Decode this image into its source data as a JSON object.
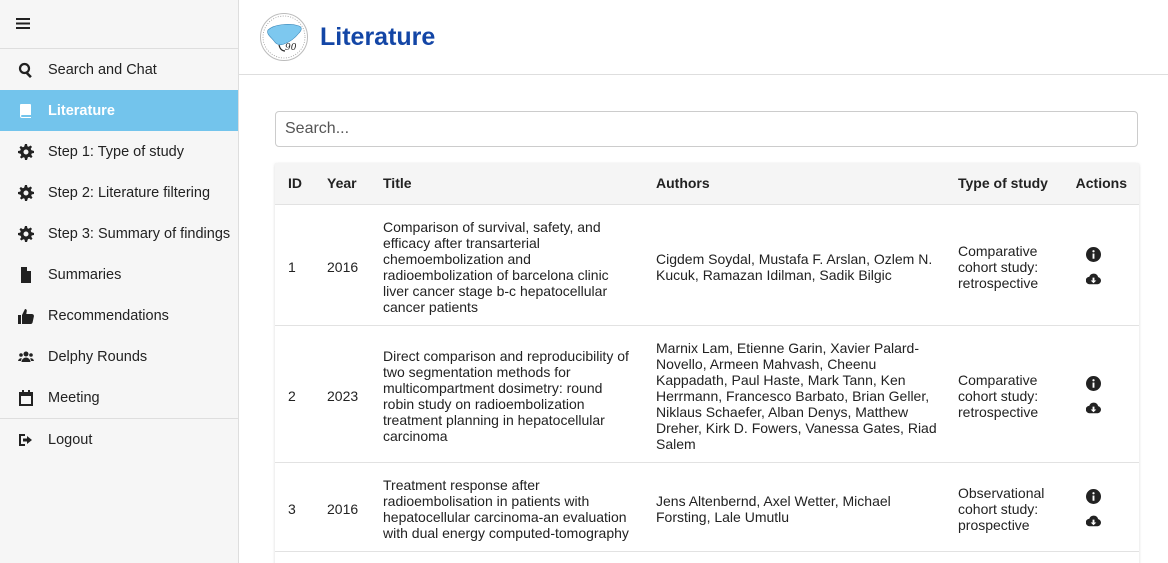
{
  "sidebar": {
    "items": [
      {
        "label": "Search and Chat",
        "icon": "search-icon"
      },
      {
        "label": "Literature",
        "icon": "book-icon",
        "active": true
      },
      {
        "label": "Step 1: Type of study",
        "icon": "gear-icon"
      },
      {
        "label": "Step 2: Literature filtering",
        "icon": "gear-icon"
      },
      {
        "label": "Step 3: Summary of findings",
        "icon": "gear-icon"
      },
      {
        "label": "Summaries",
        "icon": "document-icon"
      },
      {
        "label": "Recommendations",
        "icon": "thumbs-up-icon"
      },
      {
        "label": "Delphy Rounds",
        "icon": "users-icon"
      },
      {
        "label": "Meeting",
        "icon": "calendar-icon"
      }
    ],
    "logout_label": "Logout",
    "accent": "#73c4ec"
  },
  "header": {
    "title": "Literature",
    "title_color": "#1346a6"
  },
  "search": {
    "placeholder": "Search..."
  },
  "table": {
    "columns": [
      "ID",
      "Year",
      "Title",
      "Authors",
      "Type of study",
      "Actions"
    ],
    "rows": [
      {
        "id": "1",
        "year": "2016",
        "title": "Comparison of survival, safety, and efficacy after transarterial chemoembolization and radioembolization of barcelona clinic liver cancer stage b-c hepatocellular cancer patients",
        "authors": "Cigdem Soydal, Mustafa F. Arslan, Ozlem N. Kucuk, Ramazan Idilman, Sadik Bilgic",
        "type": "Comparative cohort study: retrospective"
      },
      {
        "id": "2",
        "year": "2023",
        "title": "Direct comparison and reproducibility of two segmentation methods for multicompartment dosimetry: round robin study on radioembolization treatment planning in hepatocellular carcinoma",
        "authors": "Marnix Lam, Etienne Garin, Xavier Palard-Novello, Armeen Mahvash, Cheenu Kappadath, Paul Haste, Mark Tann, Ken Herrmann, Francesco Barbato, Brian Geller, Niklaus Schaefer, Alban Denys, Matthew Dreher, Kirk D. Fowers, Vanessa Gates, Riad Salem",
        "type": "Comparative cohort study: retrospective"
      },
      {
        "id": "3",
        "year": "2016",
        "title": "Treatment response after radioembolisation in patients with hepatocellular carcinoma-an evaluation with dual energy computed-tomography",
        "authors": "Jens Altenbernd, Axel Wetter, Michael Forsting, Lale Umutlu",
        "type": "Observational cohort study: prospective"
      }
    ]
  }
}
